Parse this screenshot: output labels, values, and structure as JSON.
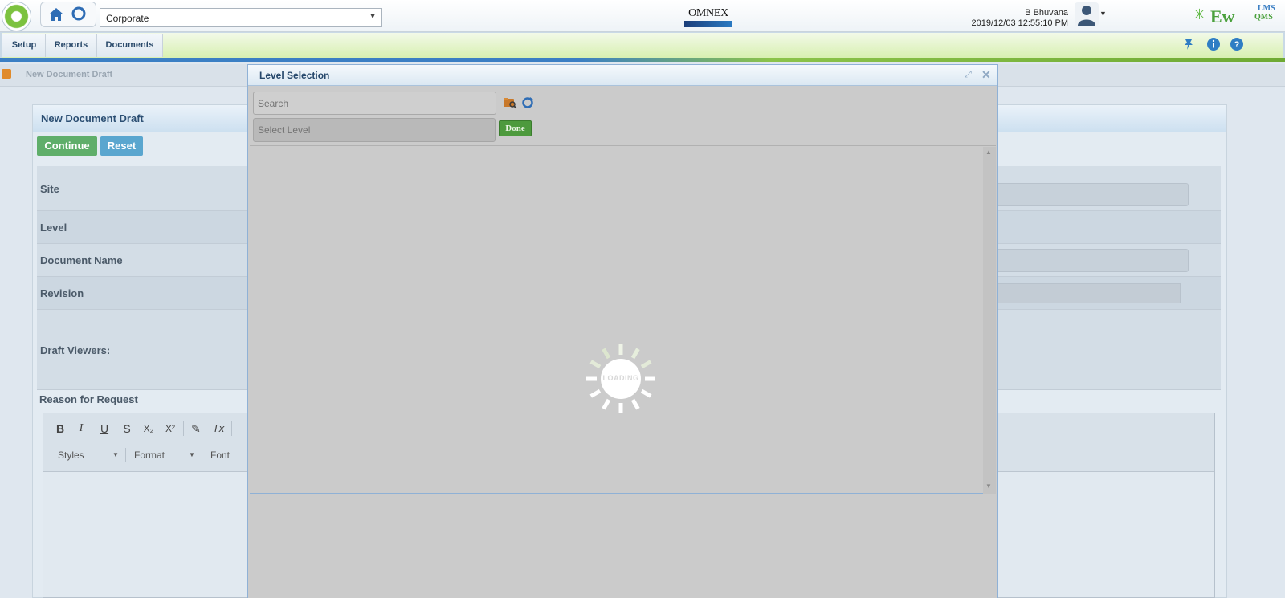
{
  "header": {
    "org_select": "Corporate",
    "brand_logo": "OMNEX",
    "user_name": "B Bhuvana",
    "datetime": "2019/12/03 12:55:10 PM",
    "product_logo_main": "Ew",
    "product_logo_lms": "LMS",
    "product_logo_qms": "QMS",
    "icons": [
      "app-logo-icon",
      "home-icon",
      "refresh-icon",
      "avatar-icon",
      "pin-icon",
      "info-icon",
      "help-icon"
    ]
  },
  "menu": {
    "items": [
      "Setup",
      "Reports",
      "Documents"
    ]
  },
  "breadcrumb": {
    "current": "New Document Draft"
  },
  "form": {
    "title": "New Document Draft",
    "continue_label": "Continue",
    "reset_label": "Reset",
    "rows": [
      "Site",
      "Level",
      "Document Name",
      "Revision",
      "Draft Viewers:"
    ],
    "reason_label": "Reason for Request",
    "editor": {
      "buttons": [
        "B",
        "I",
        "U",
        "S",
        "X₂",
        "X²",
        "✎",
        "Tx"
      ],
      "styles_label": "Styles",
      "format_label": "Format",
      "font_label": "Font"
    }
  },
  "dialog": {
    "title": "Level Selection",
    "search_placeholder": "Search",
    "level_placeholder": "Select Level",
    "done_label": "Done",
    "loading_text": "LOADING"
  },
  "colors": {
    "menu_accent": "#8bc34a",
    "header_blue": "#3b7fc4",
    "continue_green": "#5fae6a",
    "reset_blue": "#5aa6cf",
    "done_green": "#4d9a3d"
  }
}
